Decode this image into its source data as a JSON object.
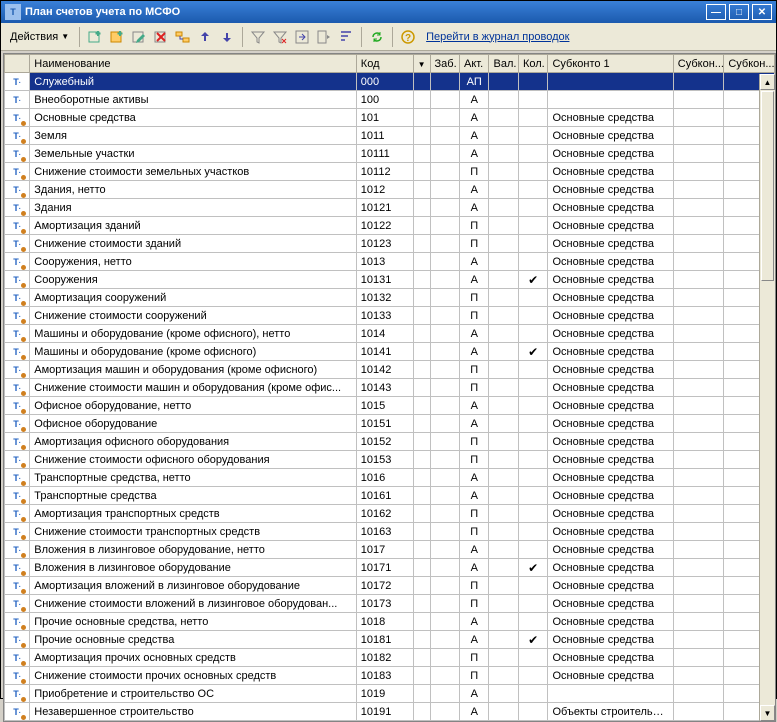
{
  "window": {
    "title": "План счетов учета по МСФО"
  },
  "toolbar": {
    "actions_label": "Действия",
    "link_label": "Перейти в журнал проводок"
  },
  "columns": {
    "name": "Наименование",
    "code": "Код",
    "zab": "Заб.",
    "akt": "Акт.",
    "val": "Вал.",
    "kol": "Кол.",
    "sub1": "Субконто 1",
    "sub2": "Субкон...",
    "sub3": "Субкон..."
  },
  "rows": [
    {
      "lvl": 0,
      "sel": true,
      "name": "Служебный",
      "code": "000",
      "akt": "АП",
      "kol": "",
      "sub1": ""
    },
    {
      "lvl": 0,
      "name": "Внеоборотные активы",
      "code": "100",
      "akt": "А",
      "kol": "",
      "sub1": ""
    },
    {
      "lvl": 1,
      "name": "Основные средства",
      "code": "101",
      "akt": "А",
      "kol": "",
      "sub1": "Основные средства"
    },
    {
      "lvl": 1,
      "name": "Земля",
      "code": "1011",
      "akt": "А",
      "kol": "",
      "sub1": "Основные средства"
    },
    {
      "lvl": 1,
      "name": "Земельные участки",
      "code": "10111",
      "akt": "А",
      "kol": "",
      "sub1": "Основные средства"
    },
    {
      "lvl": 1,
      "name": "Снижение стоимости земельных участков",
      "code": "10112",
      "akt": "П",
      "kol": "",
      "sub1": "Основные средства"
    },
    {
      "lvl": 1,
      "name": "Здания, нетто",
      "code": "1012",
      "akt": "А",
      "kol": "",
      "sub1": "Основные средства"
    },
    {
      "lvl": 1,
      "name": "Здания",
      "code": "10121",
      "akt": "А",
      "kol": "",
      "sub1": "Основные средства"
    },
    {
      "lvl": 1,
      "name": "Амортизация зданий",
      "code": "10122",
      "akt": "П",
      "kol": "",
      "sub1": "Основные средства"
    },
    {
      "lvl": 1,
      "name": "Снижение стоимости зданий",
      "code": "10123",
      "akt": "П",
      "kol": "",
      "sub1": "Основные средства"
    },
    {
      "lvl": 1,
      "name": "Сооружения, нетто",
      "code": "1013",
      "akt": "А",
      "kol": "",
      "sub1": "Основные средства"
    },
    {
      "lvl": 1,
      "name": "Сооружения",
      "code": "10131",
      "akt": "А",
      "kol": "✔",
      "sub1": "Основные средства"
    },
    {
      "lvl": 1,
      "name": "Амортизация сооружений",
      "code": "10132",
      "akt": "П",
      "kol": "",
      "sub1": "Основные средства"
    },
    {
      "lvl": 1,
      "name": "Снижение стоимости сооружений",
      "code": "10133",
      "akt": "П",
      "kol": "",
      "sub1": "Основные средства"
    },
    {
      "lvl": 1,
      "name": "Машины и оборудование (кроме офисного), нетто",
      "code": "1014",
      "akt": "А",
      "kol": "",
      "sub1": "Основные средства"
    },
    {
      "lvl": 1,
      "name": "Машины и оборудование (кроме офисного)",
      "code": "10141",
      "akt": "А",
      "kol": "✔",
      "sub1": "Основные средства"
    },
    {
      "lvl": 1,
      "name": "Амортизация машин и оборудования (кроме офисного)",
      "code": "10142",
      "akt": "П",
      "kol": "",
      "sub1": "Основные средства"
    },
    {
      "lvl": 1,
      "name": "Снижение стоимости машин и оборудования (кроме офис...",
      "code": "10143",
      "akt": "П",
      "kol": "",
      "sub1": "Основные средства"
    },
    {
      "lvl": 1,
      "name": "Офисное оборудование, нетто",
      "code": "1015",
      "akt": "А",
      "kol": "",
      "sub1": "Основные средства"
    },
    {
      "lvl": 1,
      "name": "Офисное оборудование",
      "code": "10151",
      "akt": "А",
      "kol": "",
      "sub1": "Основные средства"
    },
    {
      "lvl": 1,
      "name": "Амортизация офисного оборудования",
      "code": "10152",
      "akt": "П",
      "kol": "",
      "sub1": "Основные средства"
    },
    {
      "lvl": 1,
      "name": "Снижение стоимости офисного оборудования",
      "code": "10153",
      "akt": "П",
      "kol": "",
      "sub1": "Основные средства"
    },
    {
      "lvl": 1,
      "name": "Транспортные средства, нетто",
      "code": "1016",
      "akt": "А",
      "kol": "",
      "sub1": "Основные средства"
    },
    {
      "lvl": 1,
      "name": "Транспортные средства",
      "code": "10161",
      "akt": "А",
      "kol": "",
      "sub1": "Основные средства"
    },
    {
      "lvl": 1,
      "name": "Амортизация транспортных средств",
      "code": "10162",
      "akt": "П",
      "kol": "",
      "sub1": "Основные средства"
    },
    {
      "lvl": 1,
      "name": "Снижение стоимости транспортных средств",
      "code": "10163",
      "akt": "П",
      "kol": "",
      "sub1": "Основные средства"
    },
    {
      "lvl": 1,
      "name": "Вложения в лизинговое оборудование, нетто",
      "code": "1017",
      "akt": "А",
      "kol": "",
      "sub1": "Основные средства"
    },
    {
      "lvl": 1,
      "name": "Вложения в лизинговое оборудование",
      "code": "10171",
      "akt": "А",
      "kol": "✔",
      "sub1": "Основные средства"
    },
    {
      "lvl": 1,
      "name": "Амортизация вложений в лизинговое оборудование",
      "code": "10172",
      "akt": "П",
      "kol": "",
      "sub1": "Основные средства"
    },
    {
      "lvl": 1,
      "name": "Снижение стоимости вложений в лизинговое оборудован...",
      "code": "10173",
      "akt": "П",
      "kol": "",
      "sub1": "Основные средства"
    },
    {
      "lvl": 1,
      "name": "Прочие основные средства, нетто",
      "code": "1018",
      "akt": "А",
      "kol": "",
      "sub1": "Основные средства"
    },
    {
      "lvl": 1,
      "name": "Прочие основные средства",
      "code": "10181",
      "akt": "А",
      "kol": "✔",
      "sub1": "Основные средства"
    },
    {
      "lvl": 1,
      "name": "Амортизация прочих основных средств",
      "code": "10182",
      "akt": "П",
      "kol": "",
      "sub1": "Основные средства"
    },
    {
      "lvl": 1,
      "name": "Снижение стоимости прочих основных средств",
      "code": "10183",
      "akt": "П",
      "kol": "",
      "sub1": "Основные средства"
    },
    {
      "lvl": 1,
      "name": "Приобретение и строительство  ОС",
      "code": "1019",
      "akt": "А",
      "kol": "",
      "sub1": ""
    },
    {
      "lvl": 1,
      "name": "Незавершенное строительство",
      "code": "10191",
      "akt": "А",
      "kol": "",
      "sub1": "Объекты строительства"
    }
  ]
}
